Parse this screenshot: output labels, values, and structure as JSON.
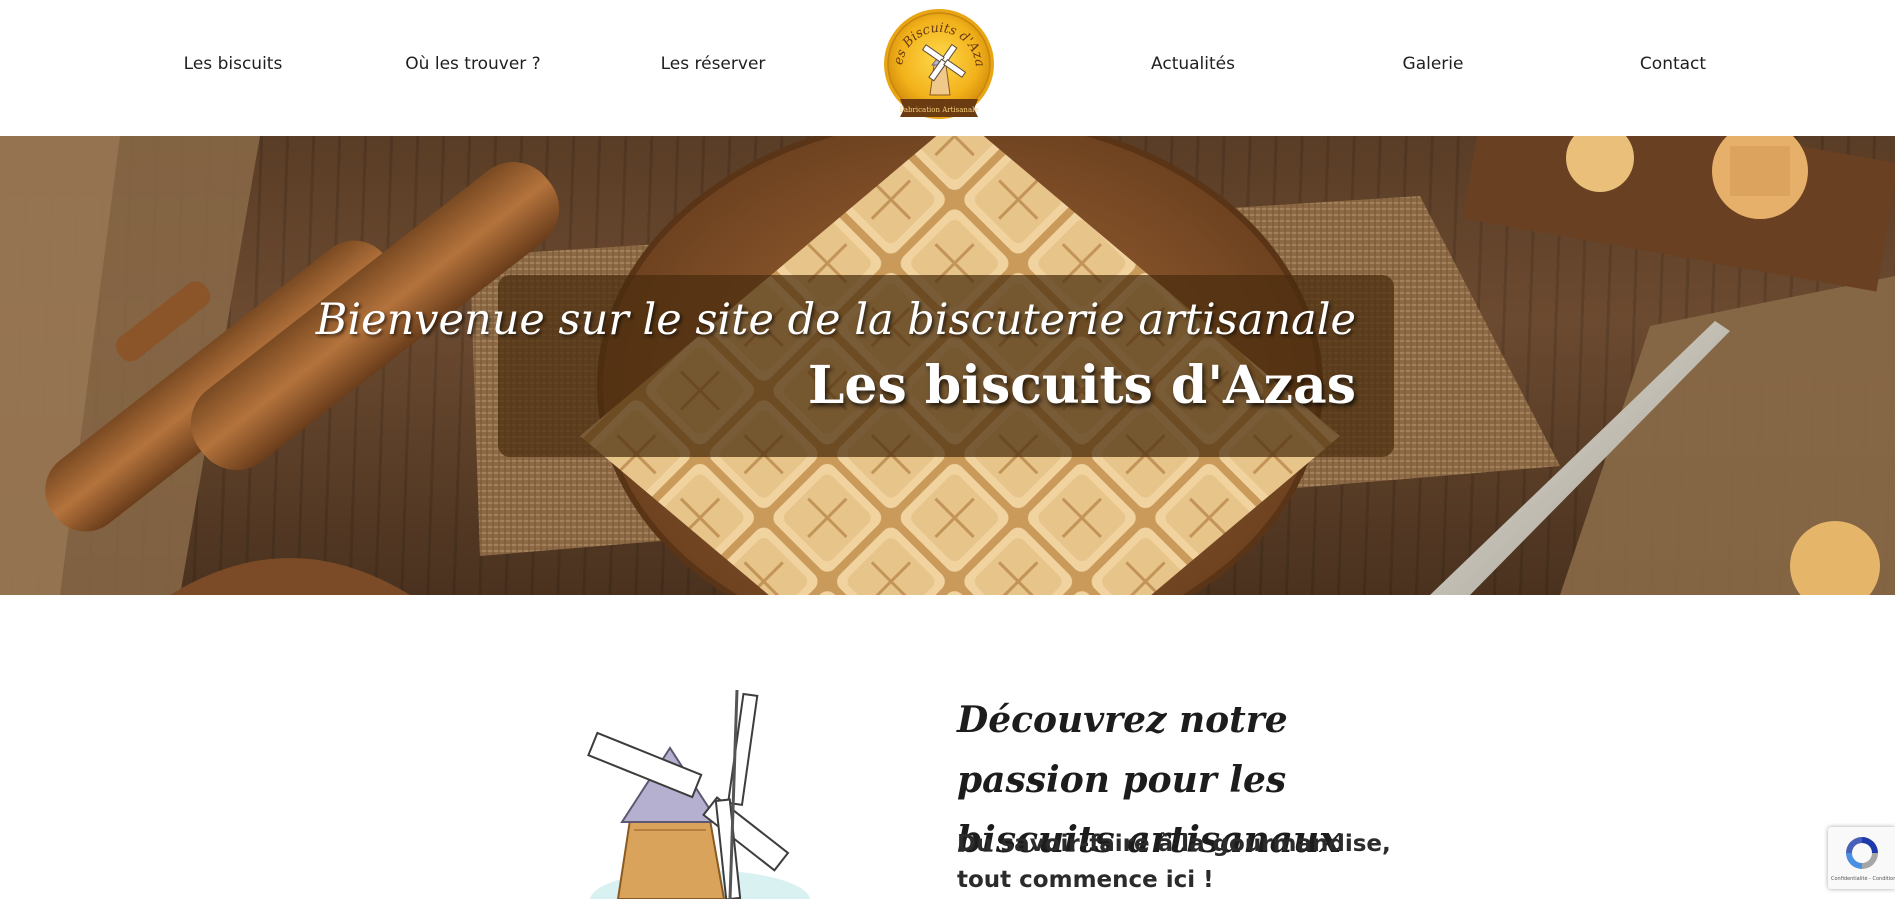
{
  "nav": {
    "items": [
      {
        "label": "Les biscuits"
      },
      {
        "label": "Où les trouver ?"
      },
      {
        "label": "Les réserver"
      },
      {
        "label": "Actualités"
      },
      {
        "label": "Galerie"
      },
      {
        "label": "Contact"
      }
    ],
    "logo": {
      "arc_text": "Les Biscuits d'Azas",
      "ribbon_text": "Fabrication Artisanale",
      "icon": "windmill-logo"
    }
  },
  "hero": {
    "line1": "Bienvenue sur le site de la biscuterie artisanale",
    "line2": "Les biscuits d'Azas"
  },
  "intro": {
    "heading": "Découvrez notre passion pour les biscuits artisanaux",
    "subheading": "Du savoir-faire à la gourmandise, tout commence ici !",
    "image_icon": "windmill-illustration"
  },
  "recaptcha": {
    "icon": "recaptcha-icon",
    "footer": "Confidentialité - Conditions"
  },
  "colors": {
    "logo_gold": "#f2b21b",
    "logo_ribbon": "#6b3b12",
    "hero_box": "#4a2c0e",
    "text_dark": "#1c1c1c"
  }
}
